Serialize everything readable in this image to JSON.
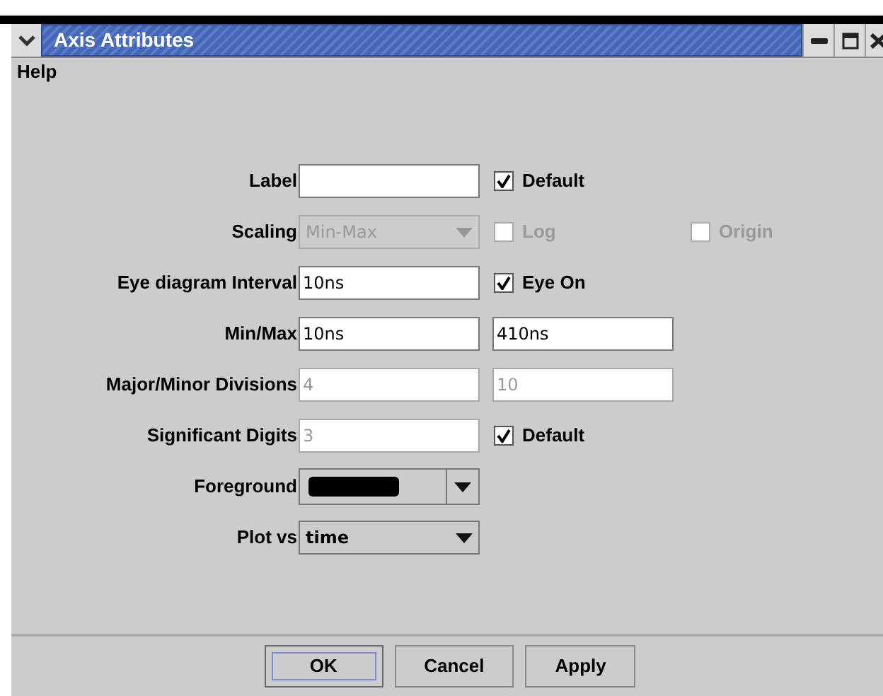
{
  "window": {
    "title": "Axis Attributes"
  },
  "menu": [
    {
      "label": "Help"
    }
  ],
  "rows": [
    {
      "label": "Label",
      "control": {
        "kind": "text",
        "disabled": false
      },
      "extras": [
        {
          "kind": "checkbox",
          "label": "Default",
          "checked": true,
          "disabled": false
        }
      ]
    },
    {
      "label": "Scaling",
      "control": {
        "kind": "combo",
        "value": "Min-Max",
        "disabled": true
      },
      "extras": [
        {
          "kind": "checkbox",
          "label": "Log",
          "checked": false,
          "disabled": true
        },
        {
          "kind": "checkbox",
          "label": "Origin",
          "checked": false,
          "disabled": true
        }
      ]
    },
    {
      "label": "Eye diagram Interval",
      "control": {
        "kind": "text",
        "value": "10ns",
        "disabled": false
      },
      "extras": [
        {
          "kind": "checkbox",
          "label": "Eye On",
          "checked": true,
          "disabled": false
        }
      ]
    },
    {
      "label": "Min/Max",
      "control": {
        "kind": "text",
        "value": "10ns",
        "disabled": false
      },
      "extras": [
        {
          "kind": "text",
          "value": "410ns",
          "disabled": false
        }
      ]
    },
    {
      "label": "Major/Minor Divisions",
      "control": {
        "kind": "text",
        "value": "4",
        "disabled": true
      },
      "extras": [
        {
          "kind": "text",
          "value": "10",
          "disabled": true
        }
      ]
    },
    {
      "label": "Significant Digits",
      "control": {
        "kind": "text",
        "value": "3",
        "disabled": true
      },
      "extras": [
        {
          "kind": "checkbox",
          "label": "Default",
          "checked": true,
          "disabled": false
        }
      ]
    },
    {
      "label": "Foreground",
      "control": {
        "kind": "color",
        "color": "#000000"
      }
    },
    {
      "label": "Plot vs",
      "control": {
        "kind": "combo",
        "value": "time",
        "disabled": false
      }
    }
  ],
  "buttons": [
    {
      "label": "OK",
      "focused": true
    },
    {
      "label": "Cancel",
      "focused": false
    },
    {
      "label": "Apply",
      "focused": false
    }
  ]
}
